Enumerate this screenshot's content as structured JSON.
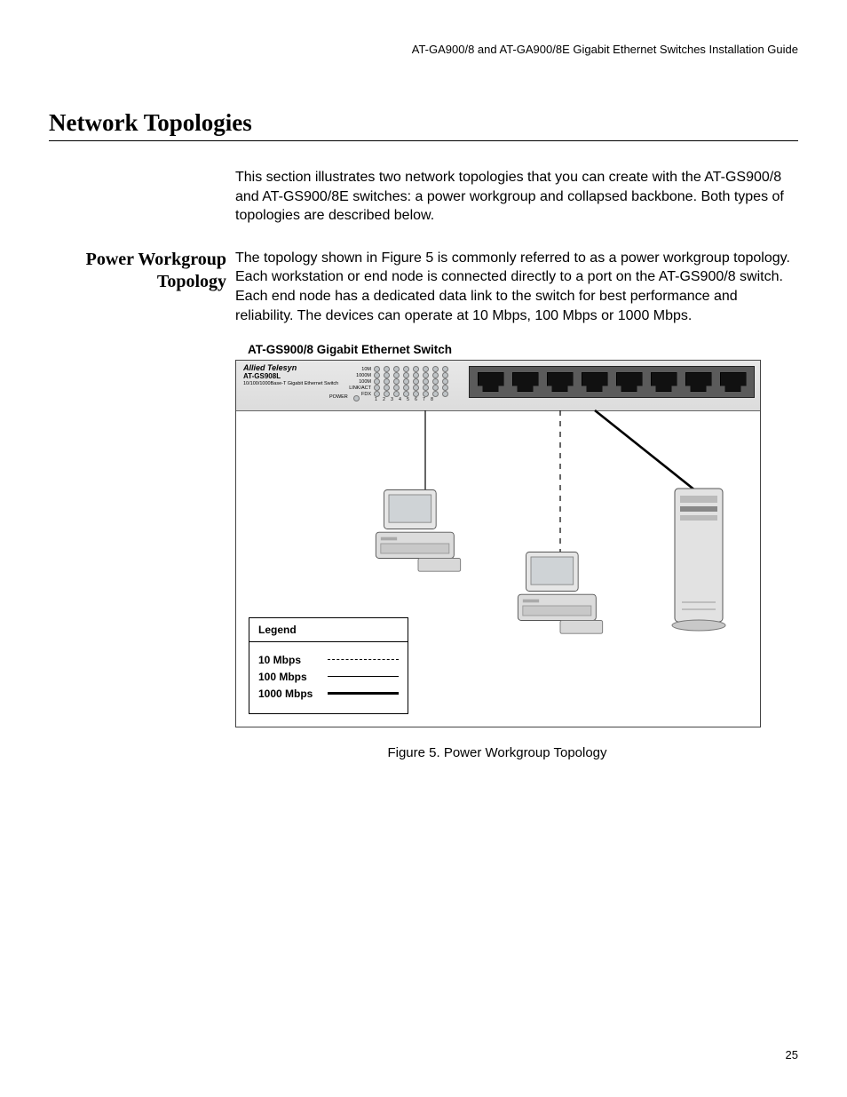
{
  "header": "AT-GA900/8 and AT-GA900/8E Gigabit Ethernet Switches Installation Guide",
  "section_title": "Network Topologies",
  "intro": "This section illustrates two network topologies that you can create with the AT-GS900/8 and AT-GS900/8E switches: a power workgroup and collapsed backbone. Both types of topologies are described below.",
  "margin_heading": "Power Workgroup Topology",
  "body": "The topology shown in Figure 5 is commonly referred to as a power workgroup topology. Each workstation or end node is connected directly to a port on the AT-GS900/8 switch. Each end node has a dedicated data link to the switch for best performance and reliability. The devices can operate at 10 Mbps, 100 Mbps or 1000 Mbps.",
  "figure": {
    "device_title": "AT-GS900/8 Gigabit Ethernet Switch",
    "caption": "Figure 5.  Power Workgroup Topology",
    "switch_label": {
      "brand": "Allied Telesyn",
      "model": "AT-GS908L",
      "desc": "10/100/1000Base-T Gigabit Ethernet Switch"
    },
    "led_labels": [
      "10M",
      "1000M",
      "100M",
      "LINK/ACT",
      "FDX"
    ],
    "power_label": "POWER",
    "port_numbers": [
      "1",
      "2",
      "3",
      "4",
      "5",
      "6",
      "7",
      "8"
    ],
    "led_numbers": [
      "1",
      "2",
      "3",
      "4",
      "5",
      "6",
      "7",
      "8"
    ],
    "legend": {
      "title": "Legend",
      "rows": [
        {
          "label": "10 Mbps",
          "style": "dash"
        },
        {
          "label": "100 Mbps",
          "style": "thin"
        },
        {
          "label": "1000 Mbps",
          "style": "thick"
        }
      ]
    }
  },
  "page_number": "25"
}
